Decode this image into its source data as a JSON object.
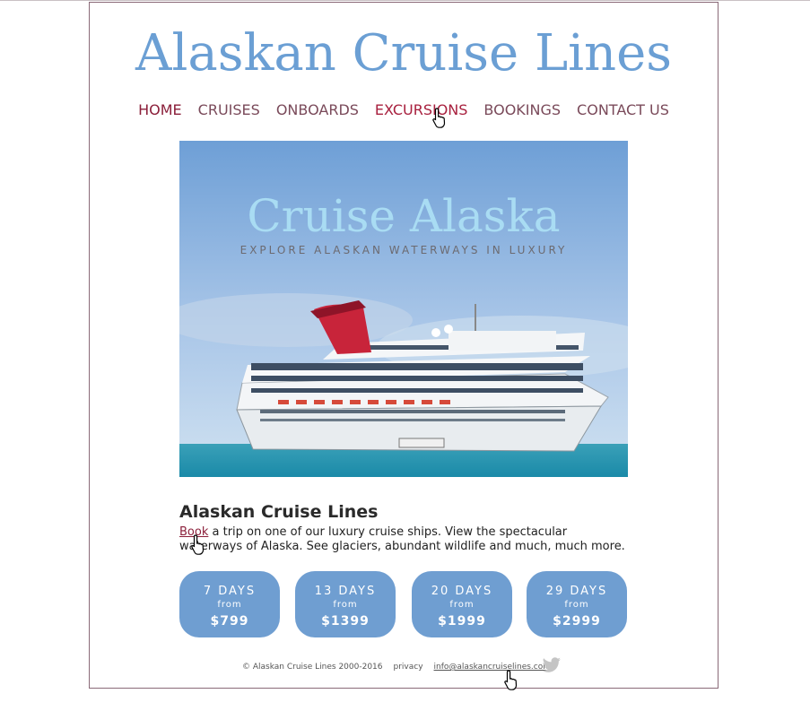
{
  "site": {
    "title": "Alaskan Cruise Lines"
  },
  "nav": {
    "items": [
      "HOME",
      "CRUISES",
      "ONBOARDS",
      "EXCURSIONS",
      "BOOKINGS",
      "CONTACT US"
    ]
  },
  "hero": {
    "title": "Cruise Alaska",
    "subtitle": "EXPLORE ALASKAN WATERWAYS IN LUXURY"
  },
  "content": {
    "heading": "Alaskan Cruise Lines",
    "book_link": "Book",
    "body": " a trip on one of our luxury cruise ships. View the spectacular waterways of Alaska. See glaciers, abundant wildlife and much, much more."
  },
  "packages": [
    {
      "days": "7 DAYS",
      "from": "from",
      "price": "$799"
    },
    {
      "days": "13 DAYS",
      "from": "from",
      "price": "$1399"
    },
    {
      "days": "20 DAYS",
      "from": "from",
      "price": "$1999"
    },
    {
      "days": "29 DAYS",
      "from": "from",
      "price": "$2999"
    }
  ],
  "footer": {
    "copyright": "© Alaskan Cruise Lines 2000-2016",
    "privacy": "privacy",
    "email": "info@alaskancruiselines.com"
  },
  "icons": {
    "twitter": "twitter-icon",
    "cursor": "hand-pointer-icon"
  },
  "colors": {
    "title": "#6b9fd4",
    "nav_active": "#8b1f3a",
    "pill": "#6f9ed1"
  }
}
